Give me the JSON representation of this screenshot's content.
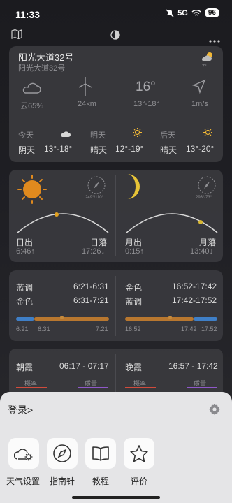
{
  "status": {
    "time": "11:33",
    "battery": "96",
    "signal": "5G"
  },
  "location_card": {
    "title": "阳光大道32号",
    "subtitle": "阳光大道32号",
    "corner_temp": "7°",
    "stats": [
      {
        "icon": "cloud-icon",
        "label": "云65%"
      },
      {
        "icon": "wind-turbine-icon",
        "label": "24km"
      },
      {
        "icon": "temperature",
        "value": "16°",
        "label": "13°-18°"
      },
      {
        "icon": "navigation-arrow-icon",
        "label": "1m/s"
      }
    ],
    "forecast": [
      {
        "day": "今天",
        "icon": "cloud-icon",
        "cond": "阴天",
        "range": "13°-18°"
      },
      {
        "day": "明天",
        "icon": "sun-icon",
        "cond": "晴天",
        "range": "12°-19°"
      },
      {
        "day": "后天",
        "icon": "sun-icon",
        "cond": "晴天",
        "range": "13°-20°"
      }
    ]
  },
  "sun_moon_card": {
    "sun": {
      "compass_text": "249°/110°",
      "rise_label": "日出",
      "set_label": "日落",
      "rise_time": "6:46↑",
      "set_time": "17:26↓"
    },
    "moon": {
      "compass_text": "293°/73°",
      "rise_label": "月出",
      "set_label": "月落",
      "rise_time": "0:15↑",
      "set_time": "13:40↓"
    }
  },
  "golden_card": {
    "left": {
      "rows": [
        {
          "label": "蓝调",
          "time": "6:21-6:31"
        },
        {
          "label": "金色",
          "time": "6:31-7:21"
        }
      ],
      "ticks": [
        "6:21",
        "6:31",
        "7:21"
      ]
    },
    "right": {
      "rows": [
        {
          "label": "金色",
          "time": "16:52-17:42"
        },
        {
          "label": "蓝调",
          "time": "17:42-17:52"
        }
      ],
      "ticks": [
        "16:52",
        "17:42",
        "17:52"
      ]
    },
    "colors": {
      "blue": "#3f7fc7",
      "gold": "#b8772f"
    }
  },
  "glow_card": {
    "morning": {
      "label": "朝霞",
      "time": "06:17 - 07:17",
      "prob": "概率",
      "quality": "质量"
    },
    "evening": {
      "label": "晚霞",
      "time": "16:57 - 17:42",
      "prob": "概率",
      "quality": "质量"
    },
    "colors": {
      "prob": "#d14b3c",
      "quality": "#8f58c9"
    }
  },
  "sheet": {
    "login": "登录>",
    "tiles": [
      {
        "icon": "weather-settings-icon",
        "label": "天气设置"
      },
      {
        "icon": "compass-icon",
        "label": "指南针"
      },
      {
        "icon": "book-icon",
        "label": "教程"
      },
      {
        "icon": "star-icon",
        "label": "评价"
      }
    ]
  }
}
